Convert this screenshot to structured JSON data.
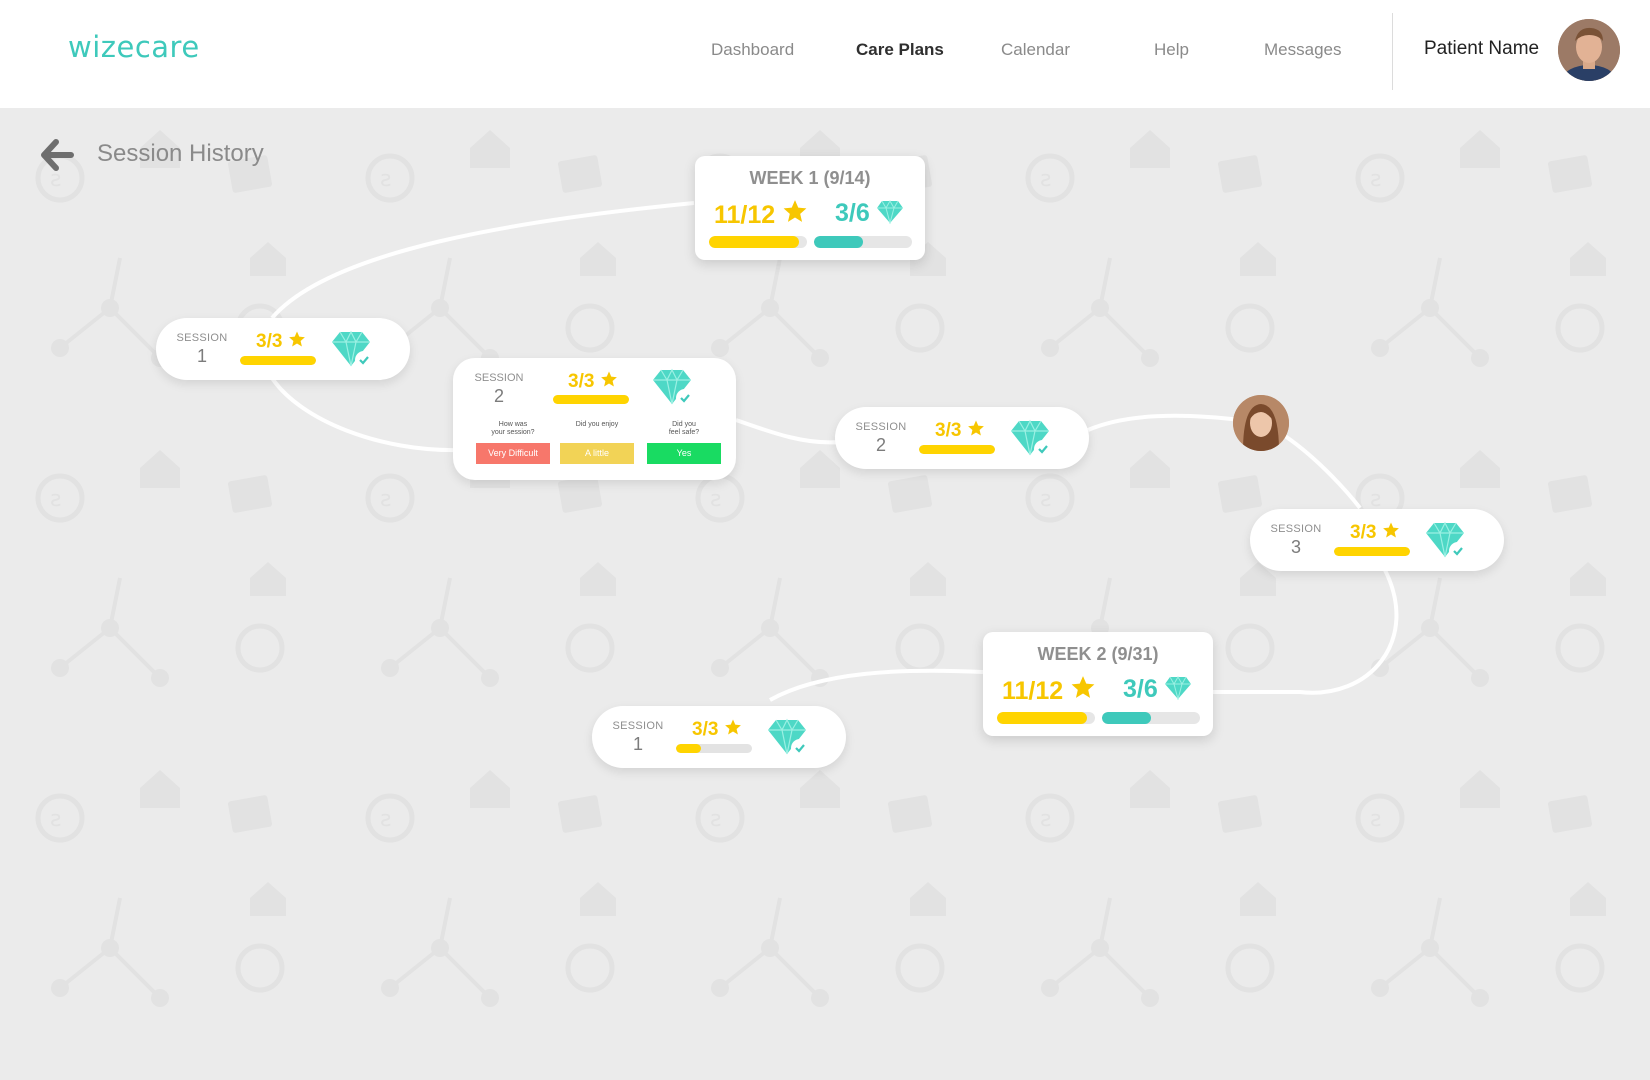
{
  "app": {
    "logo": "wizecare"
  },
  "nav": {
    "items": [
      {
        "label": "Dashboard",
        "active": false
      },
      {
        "label": "Care Plans",
        "active": true
      },
      {
        "label": "Calendar",
        "active": false
      },
      {
        "label": "Help",
        "active": false
      },
      {
        "label": "Messages",
        "active": false
      }
    ]
  },
  "user": {
    "name": "Patient Name"
  },
  "page": {
    "title": "Session History"
  },
  "colors": {
    "teal": "#3ec9bb",
    "yellow": "#ffd400",
    "score_yellow": "#f7c600",
    "very_difficult": "#f7776b",
    "a_little": "#f2d356",
    "yes": "#19db62"
  },
  "weeks": [
    {
      "title": "WEEK 1 (9/14)",
      "stars": "11/12",
      "gems": "3/6",
      "stars_progress": 0.917,
      "gems_progress": 0.5
    },
    {
      "title": "WEEK 2 (9/31)",
      "stars": "11/12",
      "gems": "3/6",
      "stars_progress": 0.917,
      "gems_progress": 0.5
    }
  ],
  "sessions": [
    {
      "label": "SESSION",
      "number": "1",
      "score": "3/3",
      "progress": 1.0,
      "gem_icon": "diamond-check-icon"
    },
    {
      "label": "SESSION",
      "number": "2",
      "score": "3/3",
      "progress": 1.0,
      "gem_icon": "diamond-check-icon",
      "questions": [
        {
          "q1": "How was",
          "q2": "your session?",
          "answer": "Very Difficult"
        },
        {
          "q1": "Did you enjoy",
          "q2": "",
          "answer": "A little"
        },
        {
          "q1": "Did you",
          "q2": "feel safe?",
          "answer": "Yes"
        }
      ]
    },
    {
      "label": "SESSION",
      "number": "2",
      "score": "3/3",
      "progress": 1.0,
      "gem_icon": "diamond-check-icon"
    },
    {
      "label": "SESSION",
      "number": "3",
      "score": "3/3",
      "progress": 1.0,
      "gem_icon": "diamond-check-icon"
    },
    {
      "label": "SESSION",
      "number": "1",
      "score": "3/3",
      "progress": 0.33,
      "gem_icon": "diamond-check-icon"
    }
  ],
  "icons": {
    "back": "arrow-left-icon",
    "star": "star-icon",
    "gem": "diamond-icon",
    "therapist": "therapist-avatar",
    "user": "user-avatar"
  }
}
